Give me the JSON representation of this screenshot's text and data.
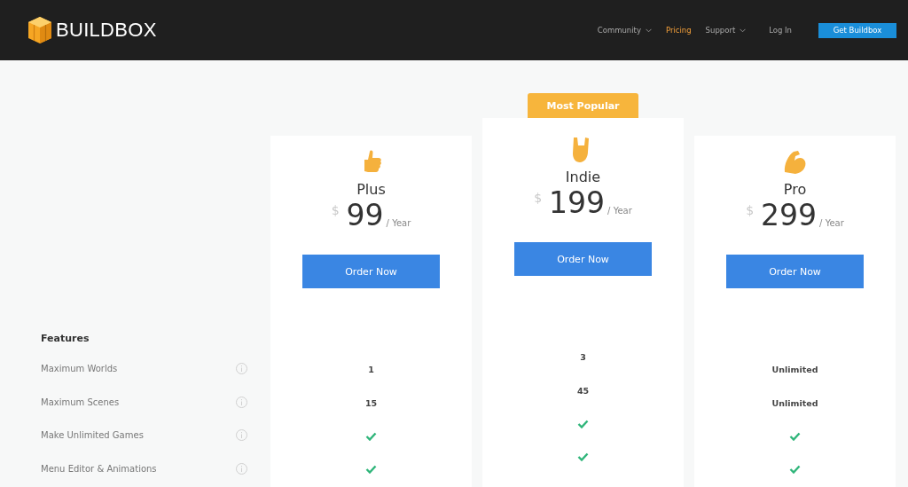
{
  "header": {
    "logo": "BUILDBOX",
    "nav": [
      {
        "label": "Community",
        "dropdown": true,
        "selected": false
      },
      {
        "label": "Pricing",
        "dropdown": false,
        "selected": true
      },
      {
        "label": "Support",
        "dropdown": true,
        "selected": false
      }
    ],
    "login": "Log In",
    "cta": "Get Buildbox"
  },
  "features": {
    "title": "Features",
    "rows": [
      "Maximum Worlds",
      "Maximum Scenes",
      "Make Unlimited Games",
      "Menu Editor & Animations"
    ]
  },
  "plans": [
    {
      "name": "Plus",
      "featured": false,
      "currency": "$",
      "price": "99",
      "period": "/ Year",
      "button": "Order Now",
      "values": [
        {
          "kind": "text",
          "text": "1"
        },
        {
          "kind": "text",
          "text": "15"
        },
        {
          "kind": "check"
        },
        {
          "kind": "check"
        }
      ]
    },
    {
      "name": "Indie",
      "featured": true,
      "badge": "Most Popular",
      "currency": "$",
      "price": "199",
      "period": "/ Year",
      "button": "Order Now",
      "values": [
        {
          "kind": "text",
          "text": "3"
        },
        {
          "kind": "text",
          "text": "45"
        },
        {
          "kind": "check"
        },
        {
          "kind": "check"
        }
      ]
    },
    {
      "name": "Pro",
      "featured": false,
      "currency": "$",
      "price": "299",
      "period": "/ Year",
      "button": "Order Now",
      "values": [
        {
          "kind": "text",
          "text": "Unlimited"
        },
        {
          "kind": "text",
          "text": "Unlimited"
        },
        {
          "kind": "check"
        },
        {
          "kind": "check"
        }
      ]
    }
  ]
}
